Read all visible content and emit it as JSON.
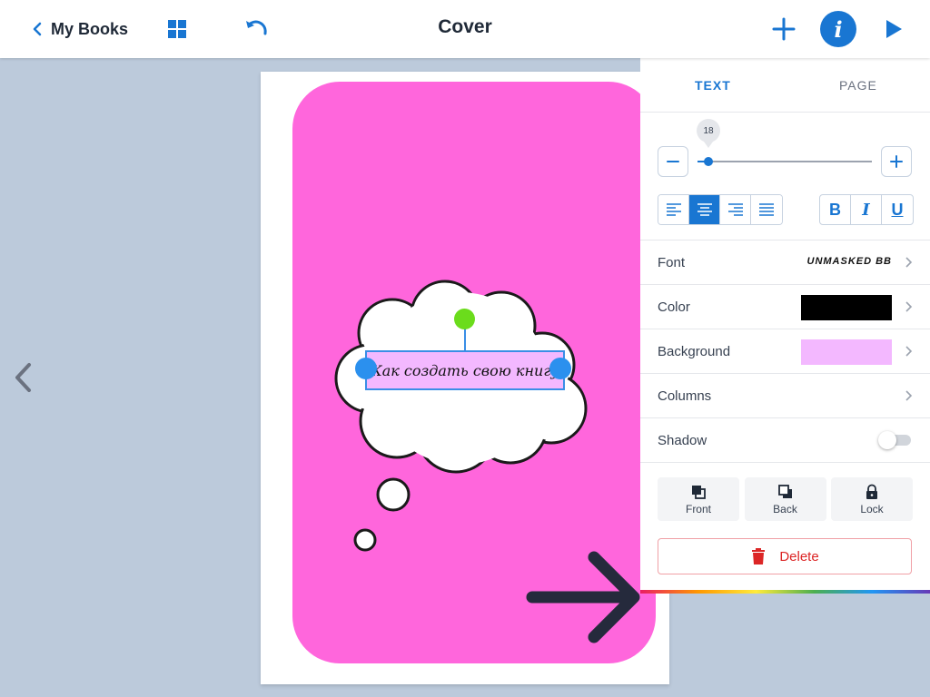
{
  "topbar": {
    "back_label": "My Books",
    "title": "Cover"
  },
  "icons": {
    "back": "chevron-left-icon",
    "grid": "grid-icon",
    "undo": "undo-icon",
    "add": "plus-icon",
    "info": "info-icon",
    "play": "play-icon"
  },
  "canvas": {
    "text": "Как создать свою книгу",
    "card_color": "#ff66dc",
    "text_bg_color": "#f3b8ff"
  },
  "panel": {
    "tabs": [
      {
        "label": "TEXT",
        "active": true
      },
      {
        "label": "PAGE",
        "active": false
      }
    ],
    "font_size": "18",
    "font_size_fraction": 0.06,
    "align_options": [
      "left",
      "center",
      "right",
      "justify"
    ],
    "align_active": "center",
    "style_buttons": [
      "B",
      "I",
      "U"
    ],
    "rows": {
      "font_label": "Font",
      "font_value": "UNMASKED BB",
      "color_label": "Color",
      "color_value": "#000000",
      "background_label": "Background",
      "background_value": "#f3b8ff",
      "columns_label": "Columns",
      "shadow_label": "Shadow",
      "shadow_on": false
    },
    "actions": {
      "front": "Front",
      "back": "Back",
      "lock": "Lock"
    },
    "delete_label": "Delete"
  },
  "colors": {
    "accent": "#1976d2",
    "danger": "#dc2626",
    "canvas_bg": "#bccadb"
  }
}
